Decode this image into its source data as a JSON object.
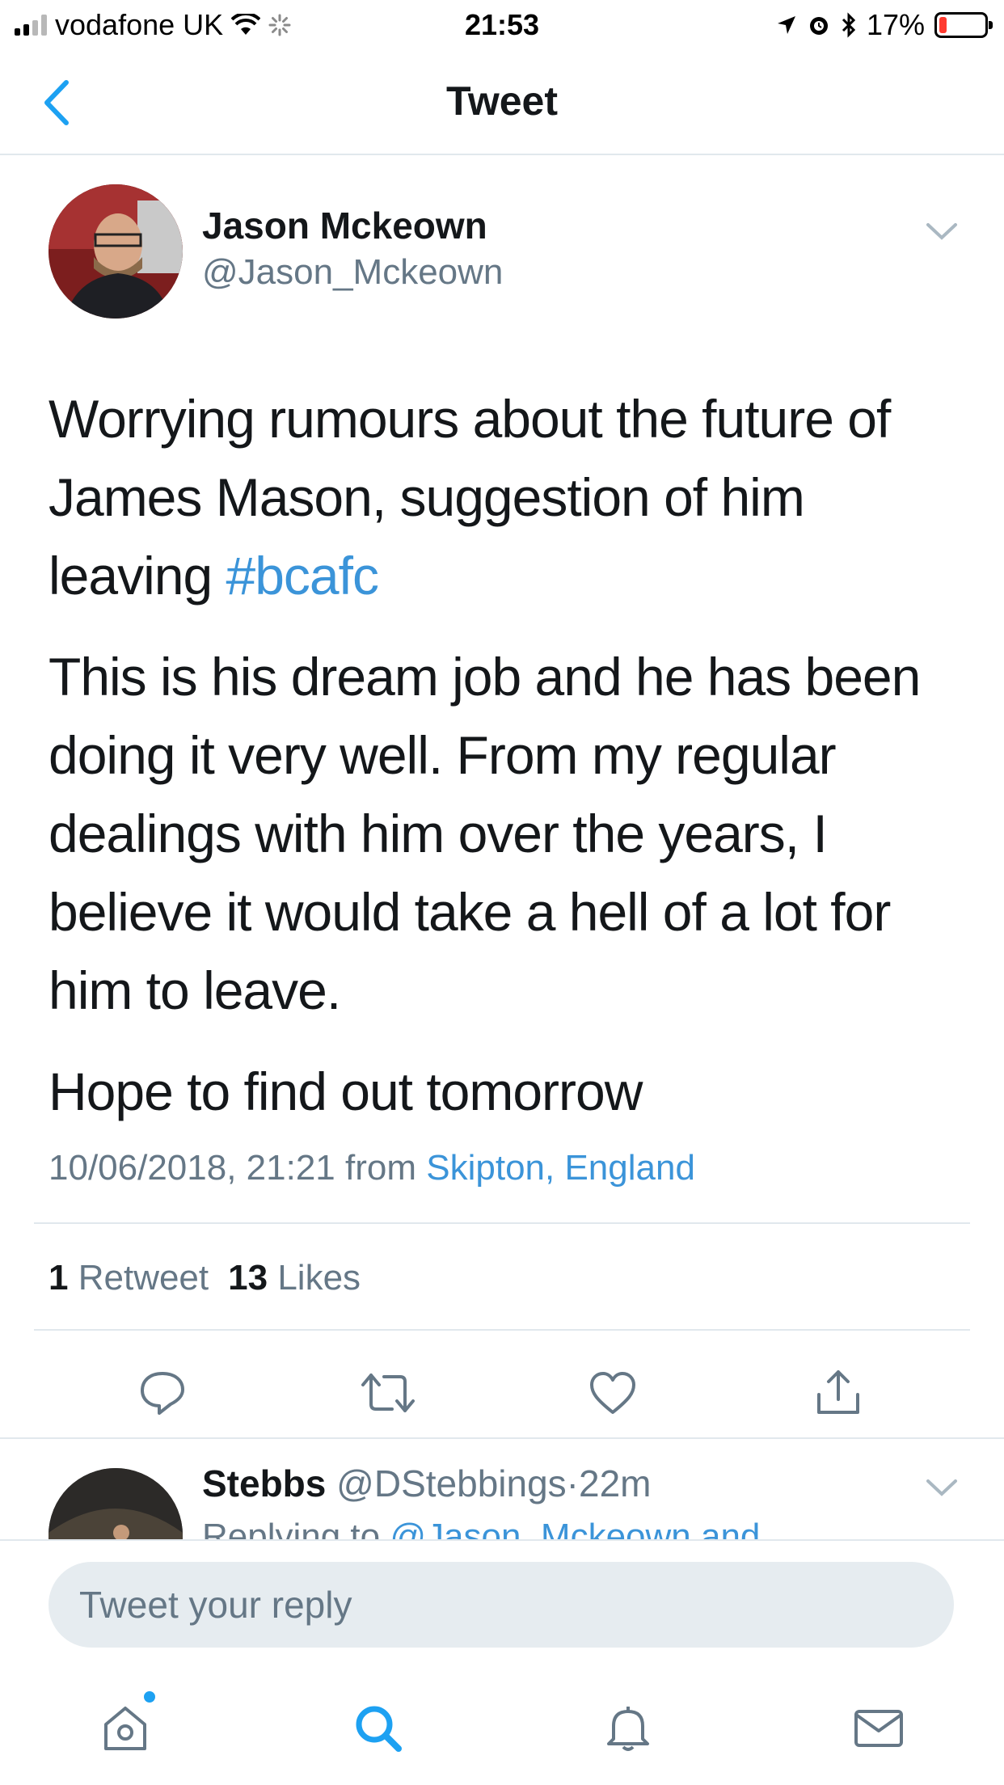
{
  "status_bar": {
    "carrier": "vodafone UK",
    "time": "21:53",
    "battery": "17%",
    "battery_level": 0.17
  },
  "nav": {
    "title": "Tweet",
    "back_icon": "chevron-left-icon"
  },
  "tweet": {
    "author_name": "Jason Mckeown",
    "author_handle": "@Jason_Mckeown",
    "paragraph_1_text": "Worrying rumours about the future of James Mason, suggestion of him leaving ",
    "hashtag": "#bcafc",
    "paragraph_2": "This is his dream job and he has been doing it very well. From my regular dealings with him over the years, I believe it would take a hell of a lot for him to leave.",
    "paragraph_3": "Hope to find out tomorrow",
    "timestamp": "10/06/2018, 21:21",
    "from_label": "from",
    "location": "Skipton, England",
    "retweet_count": "1",
    "retweet_label": "Retweet",
    "like_count": "13",
    "like_label": "Likes"
  },
  "actions": [
    {
      "icon": "reply-icon"
    },
    {
      "icon": "retweet-icon"
    },
    {
      "icon": "heart-icon"
    },
    {
      "icon": "share-icon"
    }
  ],
  "reply_preview": {
    "name": "Stebbs",
    "handle": "@DStebbings",
    "separator": "·",
    "time": "22m",
    "replying_to_prefix": "Replying to",
    "replying_to_mentions": "@Jason_Mckeown and"
  },
  "composer": {
    "placeholder": "Tweet your reply"
  },
  "tab_bar": [
    {
      "icon": "home-icon",
      "active": false,
      "has_notification_dot": true
    },
    {
      "icon": "search-icon",
      "active": true
    },
    {
      "icon": "bell-icon",
      "active": false
    },
    {
      "icon": "mail-icon",
      "active": false
    }
  ],
  "colors": {
    "accent": "#1da1f2",
    "link": "#3b94d9",
    "secondary_text": "#657786",
    "primary_text": "#14171a",
    "divider": "#e1e8ed",
    "battery_low": "#ff3b30"
  }
}
